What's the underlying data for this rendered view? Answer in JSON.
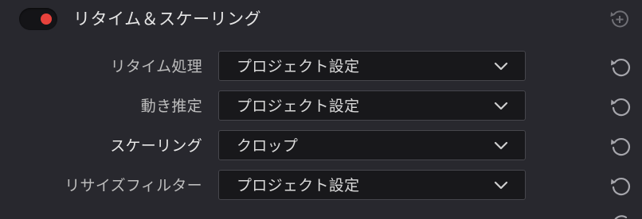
{
  "header": {
    "title": "リタイム＆スケーリング",
    "toggle_on": true,
    "toggle_color": "#e8423c",
    "action_icon": "circle-plus-reset-icon"
  },
  "rows": [
    {
      "label": "リタイム処理",
      "value": "プロジェクト設定",
      "highlight": false
    },
    {
      "label": "動き推定",
      "value": "プロジェクト設定",
      "highlight": false
    },
    {
      "label": "スケーリング",
      "value": "クロップ",
      "highlight": true
    },
    {
      "label": "リサイズフィルター",
      "value": "プロジェクト設定",
      "highlight": false
    }
  ],
  "icons": {
    "reset": "reset-icon",
    "dropdown": "chevron-down-icon"
  }
}
